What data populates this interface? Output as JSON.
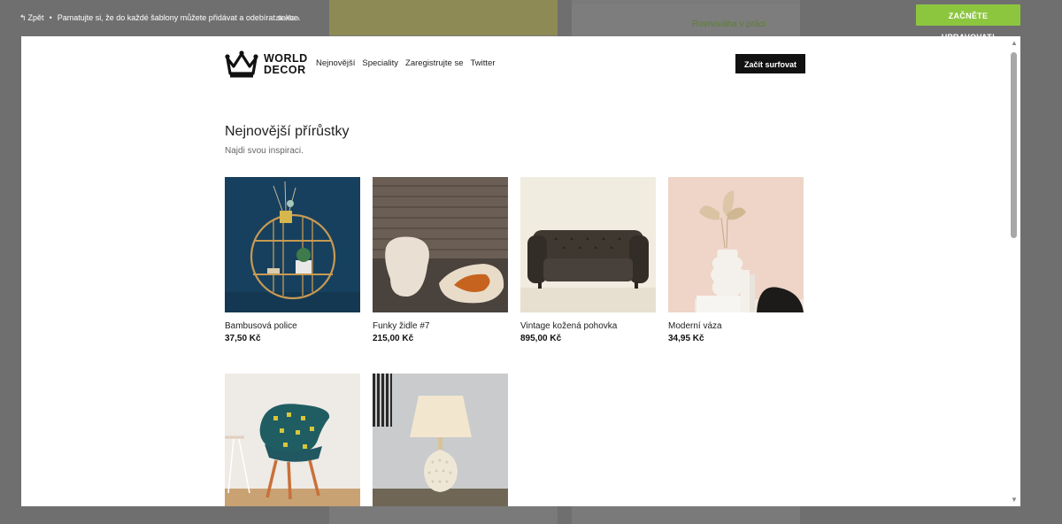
{
  "topbar": {
    "back_label": "Zpět",
    "hint": "Pamatujte si, že do každé šablony můžete přidávat a odebírat sekce.",
    "bg_link": "zit vše",
    "bg_text": "Rovnováha v práci",
    "start_edit_label": "ZAČNĚTE UPRAVOVAT!"
  },
  "site": {
    "logo_line1": "WORLD",
    "logo_line2": "DECOR",
    "nav": [
      "Nejnovější",
      "Speciality",
      "Zaregistrujte se",
      "Twitter"
    ],
    "cta_label": "Začít surfovat"
  },
  "section": {
    "title": "Nejnovější přírůstky",
    "subtitle": "Najdi svou inspiraci."
  },
  "products": [
    {
      "name": "Bambusová police",
      "price": "37,50 Kč"
    },
    {
      "name": "Funky židle #7",
      "price": "215,00 Kč"
    },
    {
      "name": "Vintage kožená pohovka",
      "price": "895,00 Kč"
    },
    {
      "name": "Moderní váza",
      "price": "34,95 Kč"
    },
    {
      "name": "",
      "price": ""
    },
    {
      "name": "",
      "price": ""
    }
  ],
  "colors": {
    "accent_green": "#8cc63f",
    "cta_black": "#111111"
  }
}
